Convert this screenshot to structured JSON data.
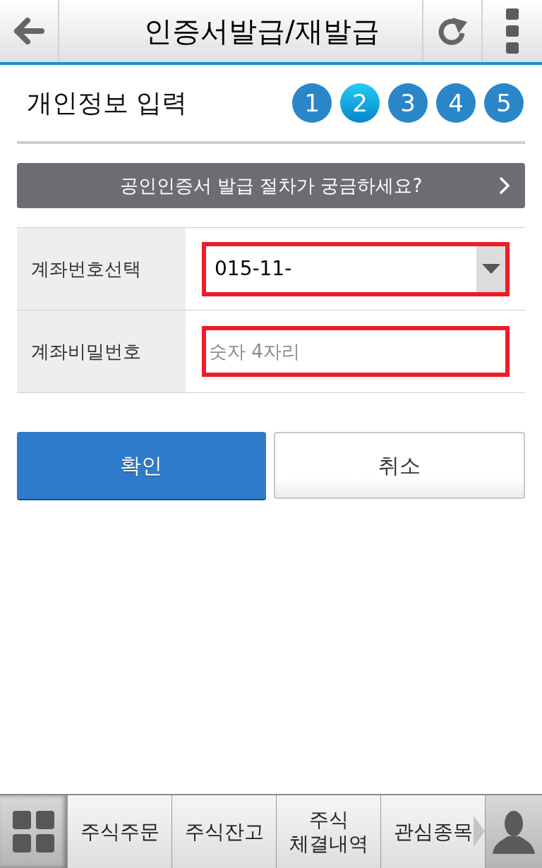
{
  "header": {
    "title": "인증서발급/재발급"
  },
  "step_header": {
    "title": "개인정보 입력",
    "steps": [
      {
        "label": "1",
        "selected": false
      },
      {
        "label": "2",
        "selected": true
      },
      {
        "label": "3",
        "selected": false
      },
      {
        "label": "4",
        "selected": false
      },
      {
        "label": "5",
        "selected": false
      }
    ]
  },
  "help_banner": {
    "label": "공인인증서 발급 절차가 궁금하세요?"
  },
  "form": {
    "rows": [
      {
        "kind": "select",
        "label": "계좌번호선택",
        "value": "015-11-",
        "highlighted": true
      },
      {
        "kind": "input",
        "label": "계좌비밀번호",
        "placeholder": "숫자 4자리",
        "highlighted": true
      }
    ]
  },
  "buttons": [
    {
      "kind": "primary",
      "label": "확인"
    },
    {
      "kind": "secondary",
      "label": "취소"
    }
  ],
  "bottom_nav": {
    "tabs": [
      {
        "label": "주식주문"
      },
      {
        "label": "주식잔고"
      },
      {
        "label": "주식\n체결내역"
      },
      {
        "label": "관심종목"
      }
    ]
  }
}
